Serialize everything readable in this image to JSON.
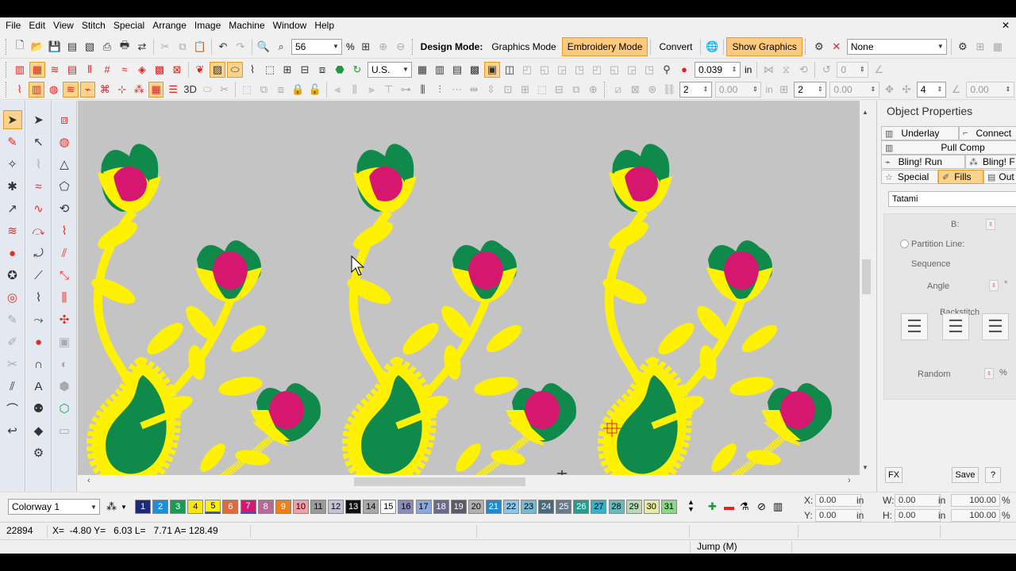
{
  "menu": [
    "File",
    "Edit",
    "View",
    "Stitch",
    "Special",
    "Arrange",
    "Image",
    "Machine",
    "Window",
    "Help"
  ],
  "toolbar1": {
    "zoom_value": "56",
    "zoom_unit": "%",
    "design_mode_label": "Design Mode:",
    "graphics_mode": "Graphics Mode",
    "embroidery_mode": "Embroidery Mode",
    "convert": "Convert",
    "show_graphics": "Show Graphics",
    "hoop_value": "None"
  },
  "toolbar2": {
    "units_value": "U.S.",
    "stitch_length": "0.039",
    "stitch_length_unit": "in",
    "spacing_value": "0"
  },
  "toolbar3": {
    "count_a": "2",
    "value_a": "0.00",
    "unit_a": "in",
    "count_b": "2",
    "value_b": "0.00",
    "count_c": "4",
    "value_c": "0.00"
  },
  "properties": {
    "title": "Object Properties",
    "tabs": {
      "underlay": "Underlay",
      "connectors": "Connect",
      "pull_comp": "Pull Comp",
      "bling_run": "Bling! Run",
      "bling_fill": "Bling! F",
      "special": "Special",
      "fills": "Fills",
      "outlines": "Out"
    },
    "fill_type": "Tatami",
    "b_label": "B:",
    "partition_line": "Partition Line:",
    "sequence": "Sequence",
    "angle": "Angle",
    "angle_unit": "°",
    "backstitch": "Backstitch",
    "random": "Random",
    "random_unit": "%",
    "fx": "FX",
    "save": "Save",
    "help": "?"
  },
  "colorbar": {
    "colorway": "Colorway 1",
    "swatches": [
      {
        "n": "1",
        "c": "#1b2a7a",
        "t": "#ffffff"
      },
      {
        "n": "2",
        "c": "#1e8fd6",
        "t": "#ffffff"
      },
      {
        "n": "3",
        "c": "#1a9a56",
        "t": "#ffffff"
      },
      {
        "n": "4",
        "c": "#f7e814",
        "t": "#000000"
      },
      {
        "n": "5",
        "c": "#fff200",
        "t": "#000000"
      },
      {
        "n": "6",
        "c": "#e06a3c",
        "t": "#ffffff"
      },
      {
        "n": "7",
        "c": "#d6176f",
        "t": "#ffffff"
      },
      {
        "n": "8",
        "c": "#b56a9a",
        "t": "#ffffff"
      },
      {
        "n": "9",
        "c": "#ef7f1a",
        "t": "#ffffff"
      },
      {
        "n": "10",
        "c": "#f2a0a6",
        "t": "#000000"
      },
      {
        "n": "11",
        "c": "#9a9a9a",
        "t": "#000000"
      },
      {
        "n": "12",
        "c": "#c2c2d6",
        "t": "#000000"
      },
      {
        "n": "13",
        "c": "#101010",
        "t": "#ffffff"
      },
      {
        "n": "14",
        "c": "#a8a8a8",
        "t": "#000000"
      },
      {
        "n": "15",
        "c": "#ffffff",
        "t": "#000000"
      },
      {
        "n": "16",
        "c": "#8a8ab8",
        "t": "#000000"
      },
      {
        "n": "17",
        "c": "#8aa8d8",
        "t": "#000000"
      },
      {
        "n": "18",
        "c": "#6a6a8a",
        "t": "#ffffff"
      },
      {
        "n": "19",
        "c": "#5a5a6a",
        "t": "#ffffff"
      },
      {
        "n": "20",
        "c": "#b0b0b0",
        "t": "#000000"
      },
      {
        "n": "21",
        "c": "#1f8ad0",
        "t": "#ffffff"
      },
      {
        "n": "22",
        "c": "#8ec6e8",
        "t": "#000000"
      },
      {
        "n": "23",
        "c": "#7ab8d0",
        "t": "#000000"
      },
      {
        "n": "24",
        "c": "#4a6a7a",
        "t": "#ffffff"
      },
      {
        "n": "25",
        "c": "#6a7a8a",
        "t": "#ffffff"
      },
      {
        "n": "26",
        "c": "#2a9a8a",
        "t": "#ffffff"
      },
      {
        "n": "27",
        "c": "#3ab0c8",
        "t": "#000000"
      },
      {
        "n": "28",
        "c": "#6ab8b8",
        "t": "#000000"
      },
      {
        "n": "29",
        "c": "#b8d8b8",
        "t": "#000000"
      },
      {
        "n": "30",
        "c": "#e8e8a8",
        "t": "#000000"
      },
      {
        "n": "31",
        "c": "#8ad88a",
        "t": "#000000"
      }
    ],
    "x_label": "X:",
    "x_value": "0.00",
    "x_unit": "in",
    "y_label": "Y:",
    "y_value": "0.00",
    "y_unit": "in",
    "w_label": "W:",
    "w_value": "0.00",
    "w_unit": "in",
    "w_pct": "100.00",
    "h_label": "H:",
    "h_value": "0.00",
    "h_unit": "in",
    "h_pct": "100.00",
    "pct_unit": "%"
  },
  "status": {
    "stitch_count": "22894",
    "coords": "X=  -4.80 Y=   6.03 L=   7.71 A= 128.49",
    "mode": "Jump (M)"
  },
  "colors": {
    "yellow": "#fff200",
    "green": "#108a4a",
    "magenta": "#d6176f",
    "canvas": "#c4c4c4",
    "accent": "#fbd38a"
  }
}
